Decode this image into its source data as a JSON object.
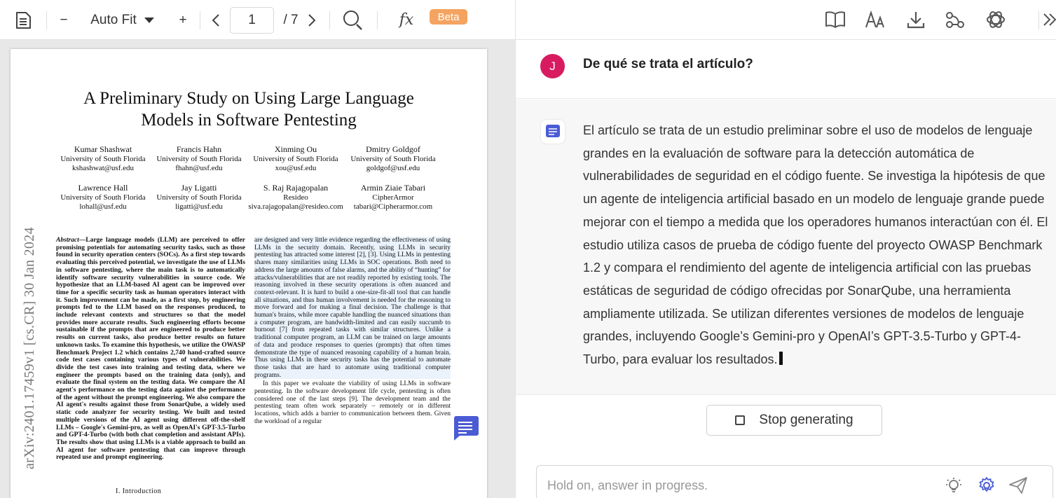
{
  "pdf_toolbar": {
    "zoom_out": "−",
    "zoom_mode": "Auto Fit",
    "zoom_in": "+",
    "page_current": "1",
    "page_total": "/ 7",
    "beta_badge": "Beta"
  },
  "paper": {
    "title_line1": "A Preliminary Study on Using Large Language",
    "title_line2": "Models in Software Pentesting",
    "authors": [
      {
        "name": "Kumar Shashwat",
        "affil": "University of South Florida",
        "email": "kshashwat@usf.edu"
      },
      {
        "name": "Francis Hahn",
        "affil": "University of South Florida",
        "email": "fhahn@usf.edu"
      },
      {
        "name": "Xinming Ou",
        "affil": "University of South Florida",
        "email": "xou@usf.edu"
      },
      {
        "name": "Dmitry Goldgof",
        "affil": "University of South Florida",
        "email": "goldgof@usf.edu"
      },
      {
        "name": "Lawrence Hall",
        "affil": "University of South Florida",
        "email": "lohall@usf.edu"
      },
      {
        "name": "Jay Ligatti",
        "affil": "University of South Florida",
        "email": "ligatti@usf.edu"
      },
      {
        "name": "S. Raj Rajagopalan",
        "affil": "Resideo",
        "email": "siva.rajagopalan@resideo.com"
      },
      {
        "name": "Armin Ziaie Tabari",
        "affil": "CipherArmor",
        "email": "tabari@Cipherarmor.com"
      }
    ],
    "arxiv_id": "arXiv:2401.17459v1  [cs.CR]  30 Jan 2024",
    "abstract_label": "Abstract",
    "abstract_text": "—Large language models (LLM) are perceived to offer promising potentials for automating security tasks, such as those found in security operation centers (SOCs). As a first step towards evaluating this perceived potential, we investigate the use of LLMs in software pentesting, where the main task is to automatically identify software security vulnerabilities in source code. We hypothesize that an LLM-based AI agent can be improved over time for a specific security task as human operators interact with it. Such improvement can be made, as a first step, by engineering prompts fed to the LLM based on the responses produced, to include relevant contexts and structures so that the model provides more accurate results. Such engineering efforts become sustainable if the prompts that are engineered to produce better results on current tasks, also produce better results on future unknown tasks. To examine this hypothesis, we utilize the OWASP Benchmark Project 1.2 which contains 2,740 hand-crafted source code test cases containing various types of vulnerabilities. We divide the test cases into training and testing data, where we engineer the prompts based on the training data (only), and evaluate the final system on the testing data. We compare the AI agent's performance on the testing data against the performance of the agent without the prompt engineering. We also compare the AI agent's results against those from SonarQube, a widely used static code analyzer for security testing. We built and tested multiple versions of the AI agent using different off-the-shelf LLMs – Google's Gemini-pro, as well as OpenAI's GPT-3.5-Turbo and GPT-4-Turbo (with both chat completion and assistant APIs). The results show that using LLMs is a viable approach to build an AI agent for software pentesting that can improve through repeated use and prompt engineering.",
    "right_col_highlight": "are designed and very little evidence regarding the effectiveness of using LLMs in the security domain. Recently, using LLMs in security pentesting has attracted some interest [2], [3]. Using LLMs in pentesting shares many similarities using LLMs in SOC operations. Both need to address the large amounts of false alarms, and the ability of “hunting” for attacks/vulnerabilities that are not readily reported by existing tools. The reasoning involved in these security operations is often nuanced and context-relevant. It is hard to build a one-size-fit-all tool that can handle all situations, and thus human involvement is needed for the reasoning to move forward and for making a final decision. The challenge is that human's brains, while more capable handling the nuanced situations than a computer program, are bandwidth-limited and can easily succumb to burnout [7] from repeated tasks with similar structures. Unlike a traditional computer program, an LLM can be trained on large amounts of data and produce responses to queries (prompts) that often times demonstrate the type of nuanced reasoning capability of a human brain. Thus using LLMs in these security tasks has the potential to automate those tasks that are hard to automate using traditional computer programs.",
    "right_col_para2": "In this paper we evaluate the viability of using LLMs in software pentesting. In the software development life cycle, pentesting is often considered one of the last steps [9]. The development team and the pentesting team often work separately – remotely or in different locations, which adds a barrier to communication between them. Given the workload of a regular",
    "intro_heading": "I. Introduction"
  },
  "chat": {
    "user_initial": "J",
    "question": "De qué se trata el artículo?",
    "answer": "El artículo se trata de un estudio preliminar sobre el uso de modelos de lenguaje grandes en la evaluación de software para la detección automática de vulnerabilidades de seguridad en el código fuente. Se investiga la hipótesis de que un agente de inteligencia artificial basado en un modelo de lenguaje grande puede mejorar con el tiempo a medida que los operadores humanos interactúan con él. El estudio utiliza casos de prueba de código fuente del proyecto OWASP Benchmark 1.2 y compara el rendimiento del agente de inteligencia artificial con las pruebas estáticas de seguridad de código ofrecidas por SonarQube, una herramienta ampliamente utilizada. Se utilizan diferentes versiones de modelos de lenguaje grandes, incluyendo Google’s Gemini-pro y OpenAI’s GPT-3.5-Turbo y GPT-4-Turbo, para evaluar los resultados.",
    "stop_label": "Stop generating",
    "input_placeholder": "Hold on, answer in progress."
  },
  "colors": {
    "avatar": "#d81b60",
    "beta": "#f4a460",
    "accent": "#4a5bd4"
  }
}
